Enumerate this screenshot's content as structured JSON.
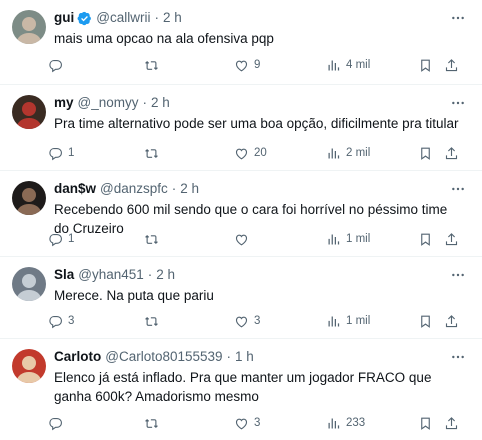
{
  "replies": [
    {
      "name": "gui",
      "verified": true,
      "handle": "@callwrii",
      "sep": "·",
      "time": "2 h",
      "text": "mais uma opcao na ala ofensiva pqp",
      "reply_count": "",
      "retweet_count": "",
      "like_count": "9",
      "views": "4 mil",
      "avatar_colors": [
        "#7d8c86",
        "#c9b8a6"
      ]
    },
    {
      "name": "my",
      "verified": false,
      "handle": "@_nomyy",
      "sep": "·",
      "time": "2 h",
      "text": "Pra time alternativo pode ser uma boa opção, dificilmente pra titular",
      "reply_count": "1",
      "retweet_count": "",
      "like_count": "20",
      "views": "2 mil",
      "avatar_colors": [
        "#3a2b22",
        "#b3362e"
      ]
    },
    {
      "name": "dan$w",
      "verified": false,
      "handle": "@danzspfc",
      "sep": "·",
      "time": "2 h",
      "text": "Recebendo 600 mil sendo que o cara foi horrível no péssimo time do Cruzeiro",
      "reply_count": "1",
      "retweet_count": "",
      "like_count": "",
      "views": "1 mil",
      "avatar_colors": [
        "#1e1b1a",
        "#8a6a55"
      ]
    },
    {
      "name": "Sla",
      "verified": false,
      "handle": "@yhan451",
      "sep": "·",
      "time": "2 h",
      "text": "Merece. Na puta que pariu",
      "reply_count": "3",
      "retweet_count": "",
      "like_count": "3",
      "views": "1 mil",
      "avatar_colors": [
        "#6f7a86",
        "#c5cdd4"
      ]
    },
    {
      "name": "Carloto",
      "verified": false,
      "handle": "@Carloto80155539",
      "sep": "·",
      "time": "1 h",
      "text": "Elenco já está inflado. Pra que manter um jogador FRACO que ganha 600k? Amadorismo mesmo",
      "reply_count": "",
      "retweet_count": "",
      "like_count": "3",
      "views": "233",
      "avatar_colors": [
        "#c23a2c",
        "#e8c9a8"
      ]
    }
  ],
  "colors": {
    "text": "#0f1419",
    "secondary": "#536471",
    "verified": "#1d9bf0",
    "divider": "#eff3f4"
  },
  "icons": [
    "more-icon",
    "reply-icon",
    "retweet-icon",
    "like-icon",
    "views-icon",
    "bookmark-icon",
    "share-icon",
    "verified-badge-icon"
  ]
}
